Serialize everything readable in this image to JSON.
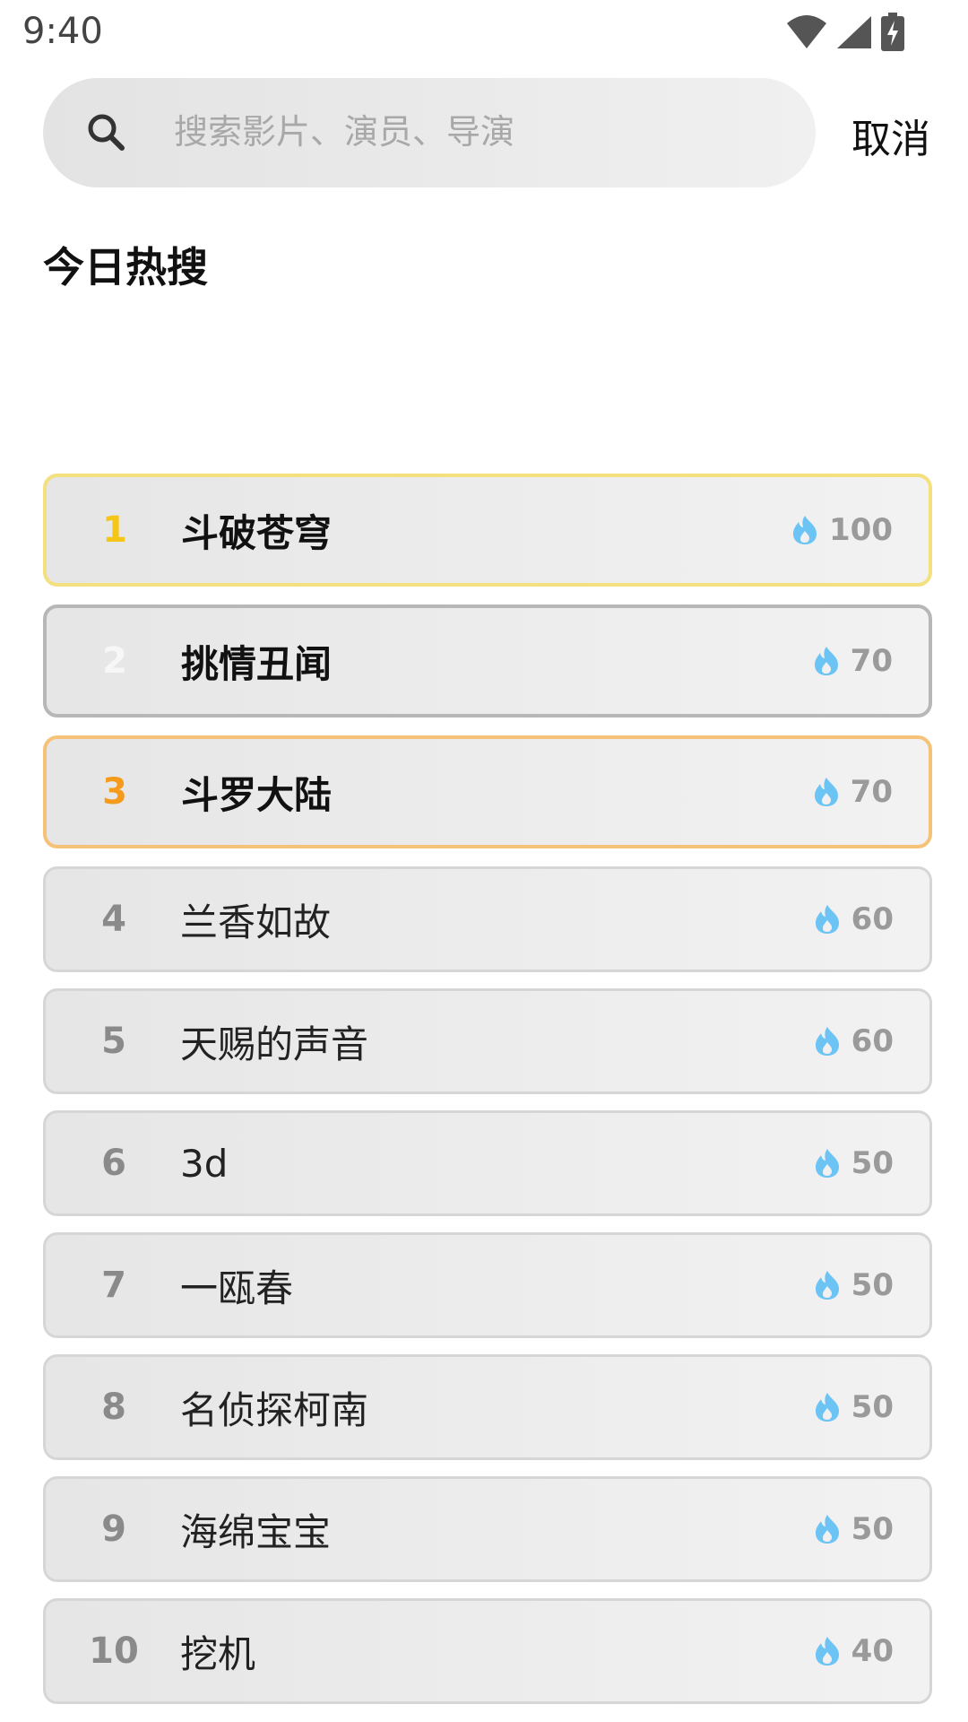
{
  "status": {
    "time": "9:40"
  },
  "search": {
    "placeholder": "搜索影片、演员、导演",
    "cancel_label": "取消"
  },
  "section": {
    "title": "今日热搜"
  },
  "hot_list": [
    {
      "rank": "1",
      "title": "斗破苍穹",
      "heat": "100"
    },
    {
      "rank": "2",
      "title": "挑情丑闻",
      "heat": "70"
    },
    {
      "rank": "3",
      "title": "斗罗大陆",
      "heat": "70"
    },
    {
      "rank": "4",
      "title": "兰香如故",
      "heat": "60"
    },
    {
      "rank": "5",
      "title": "天赐的声音",
      "heat": "60"
    },
    {
      "rank": "6",
      "title": "3d",
      "heat": "50"
    },
    {
      "rank": "7",
      "title": "一瓯春",
      "heat": "50"
    },
    {
      "rank": "8",
      "title": "名侦探柯南",
      "heat": "50"
    },
    {
      "rank": "9",
      "title": "海绵宝宝",
      "heat": "50"
    },
    {
      "rank": "10",
      "title": "挖机",
      "heat": "40"
    }
  ],
  "colors": {
    "rank1": "#f5c518",
    "rank2": "#f7f7f7",
    "rank3": "#f59a1b",
    "flame": "#6cc4f5"
  },
  "icons": {
    "search": "search-icon",
    "heat": "flame-icon",
    "wifi": "wifi-icon",
    "signal": "signal-icon",
    "battery": "battery-charging-icon"
  }
}
